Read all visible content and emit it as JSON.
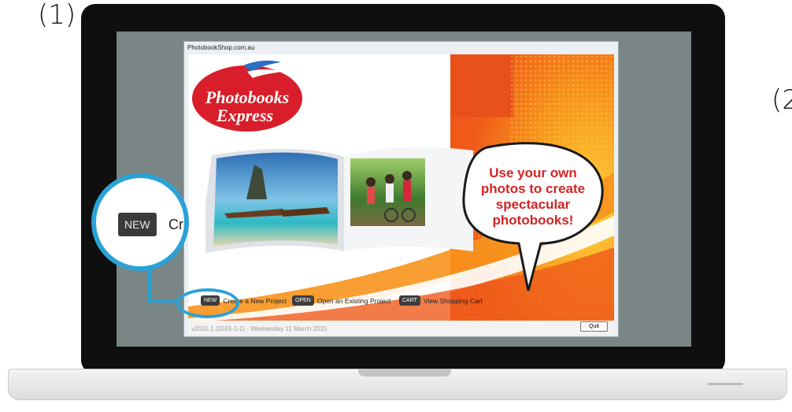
{
  "steps": {
    "left": "(1)",
    "right": "(2"
  },
  "window": {
    "title": "PhotobookShop.com.au"
  },
  "brand": {
    "logo_line1": "Photobooks",
    "logo_line2": "Express"
  },
  "speech_bubble": {
    "lines": [
      "Use your own",
      "photos to create",
      "spectacular",
      "photobooks!"
    ]
  },
  "actions": [
    {
      "key": "NEW",
      "label": "Create a New Project"
    },
    {
      "key": "OPEN",
      "label": "Open an Existing Project"
    },
    {
      "key": "CART",
      "label": "View Shopping Cart"
    }
  ],
  "quit_label": "Quit",
  "footer_text": "v2015.1 (2015-1-1) - Wednesday 11 March 2015",
  "zoom": {
    "key": "NEW",
    "label": "Crea"
  },
  "colors": {
    "highlight": "#2aa2d6",
    "logo_red": "#d81e2a",
    "bubble_text": "#d42424",
    "orange": "#f26a1b"
  }
}
